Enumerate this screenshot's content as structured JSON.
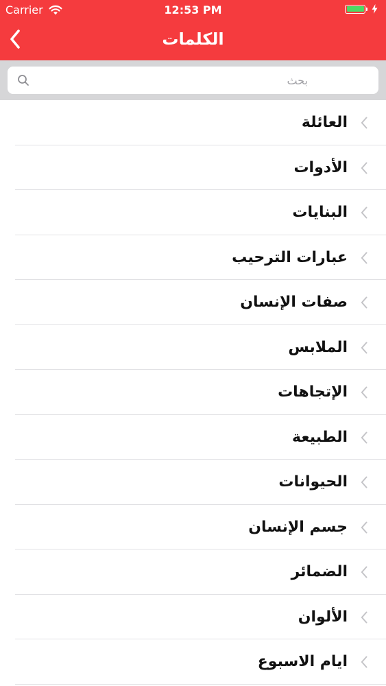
{
  "status_bar": {
    "carrier": "Carrier",
    "time": "12:53 PM"
  },
  "nav": {
    "title": "الكلمات",
    "back_icon": "chevron-left-icon"
  },
  "search": {
    "placeholder": "بحث",
    "value": ""
  },
  "categories": [
    {
      "label": "العائلة"
    },
    {
      "label": "الأدوات"
    },
    {
      "label": "البنايات"
    },
    {
      "label": "عبارات الترحيب"
    },
    {
      "label": "صفات الإنسان"
    },
    {
      "label": "الملابس"
    },
    {
      "label": "الإتجاهات"
    },
    {
      "label": "الطبيعة"
    },
    {
      "label": "الحيوانات"
    },
    {
      "label": "جسم الإنسان"
    },
    {
      "label": "الضمائر"
    },
    {
      "label": "الألوان"
    },
    {
      "label": "ايام الاسبوع"
    }
  ],
  "colors": {
    "accent": "#f53b3e",
    "search_bar_bg": "#d6d6d8",
    "battery": "#4cd964"
  }
}
